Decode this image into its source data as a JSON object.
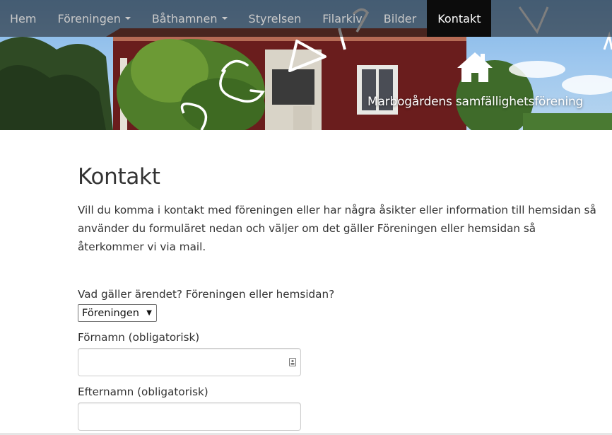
{
  "nav": {
    "items": [
      {
        "label": "Hem"
      },
      {
        "label": "Föreningen"
      },
      {
        "label": "Båthamnen"
      },
      {
        "label": "Styrelsen"
      },
      {
        "label": "Filarkiv"
      },
      {
        "label": "Bilder"
      },
      {
        "label": "Kontakt"
      }
    ],
    "active": "Kontakt"
  },
  "header": {
    "site_name": "Marbogårdens samfällighetsförening",
    "home_icon": "home-icon"
  },
  "main": {
    "title": "Kontakt",
    "intro": "Vill du komma i kontakt med föreningen eller har några åsikter eller information till hemsidan så använder du formuläret nedan och väljer om det gäller Föreningen eller hemsidan så återkommer vi via mail."
  },
  "form": {
    "topic_label": "Vad gäller ärendet? Föreningen eller hemsidan?",
    "topic_selected": "Föreningen",
    "firstname_label": "Förnamn (obligatorisk)",
    "firstname_value": "",
    "lastname_label": "Efternamn (obligatorisk)",
    "lastname_value": ""
  },
  "colors": {
    "nav_active_bg": "#0c0c0c",
    "nav_text": "#c9c9c9",
    "body_text": "#333333"
  }
}
